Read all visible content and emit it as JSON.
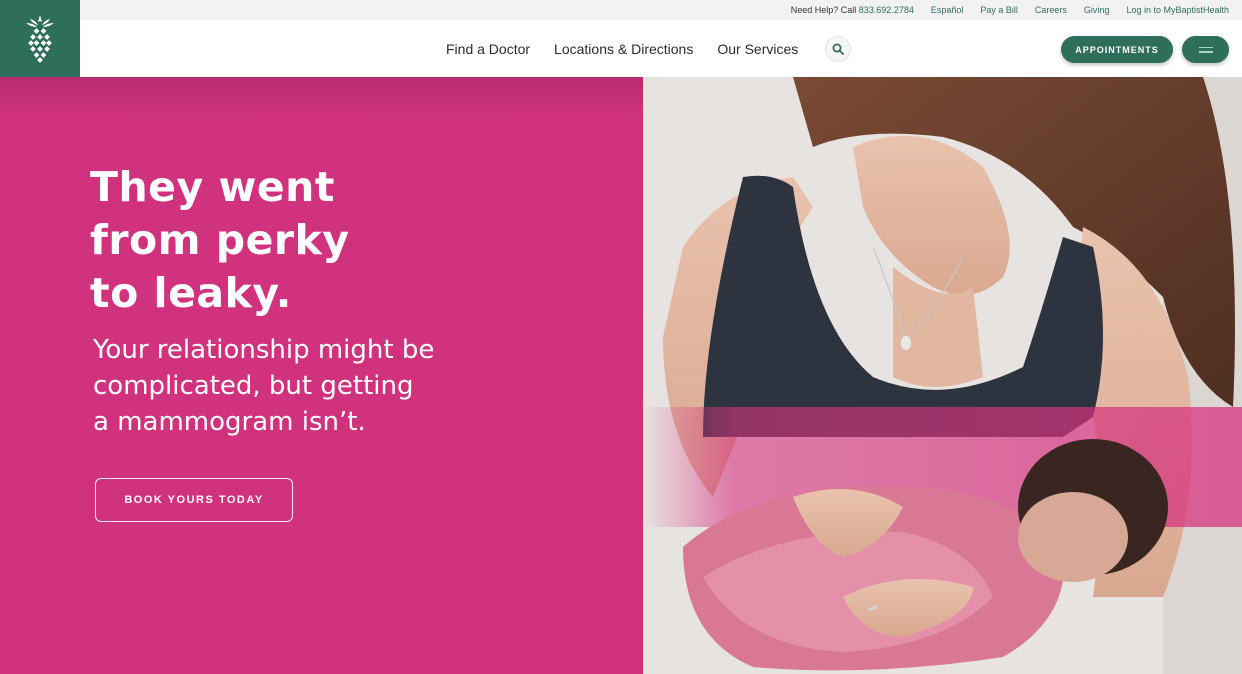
{
  "colors": {
    "brand_green": "#2f6e5a",
    "hero_pink": "#d0327e",
    "white": "#ffffff"
  },
  "utility": {
    "help_label": "Need Help? Call",
    "phone": "833.692.2784",
    "links": [
      "Español",
      "Pay a Bill",
      "Careers",
      "Giving",
      "Log in to MyBaptistHealth"
    ]
  },
  "nav": {
    "links": [
      "Find a Doctor",
      "Locations & Directions",
      "Our Services"
    ],
    "appointments_label": "APPOINTMENTS",
    "search_icon": "search-icon",
    "menu_icon": "hamburger-menu-icon",
    "logo_icon": "pineapple-logo-icon"
  },
  "hero": {
    "headline_lines": [
      "They went",
      "from perky",
      "to leaky."
    ],
    "subhead_lines": [
      "Your relationship might be",
      "complicated, but getting",
      "a mammogram isn’t."
    ],
    "cta_label": "BOOK YOURS TODAY",
    "image_subject": "mother-holding-newborn-photo"
  }
}
